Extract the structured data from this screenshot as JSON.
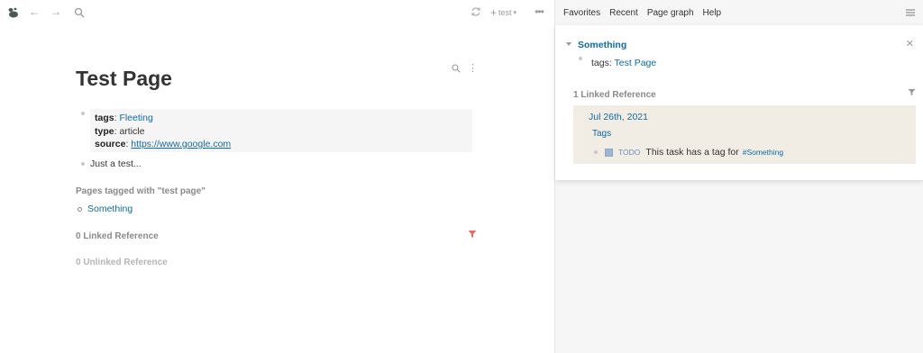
{
  "topbar": {
    "logo_icon": "logseq-logo-icon",
    "back_icon": "arrow-left-icon",
    "forward_icon": "arrow-right-icon",
    "search_icon": "search-icon",
    "sync_icon": "refresh-icon",
    "new_page_label": "test",
    "more_icon": "ellipsis-icon"
  },
  "page": {
    "title": "Test Page",
    "properties": {
      "tags_key": "tags",
      "tags_value": "Fleeting",
      "type_key": "type",
      "type_value": "article",
      "source_key": "source",
      "source_value": "https://www.google.com"
    },
    "block2": "Just a test...",
    "tagged_header": "Pages tagged with \"test page\"",
    "tagged_items": [
      "Something"
    ],
    "linked_ref": "0 Linked Reference",
    "unlinked_ref": "0 Unlinked Reference"
  },
  "sidebar": {
    "nav": [
      "Favorites",
      "Recent",
      "Page graph",
      "Help"
    ],
    "card": {
      "title": "Something",
      "tags_key": "tags",
      "tags_value": "Test Page",
      "linked_ref": "1 Linked Reference",
      "ref_date": "Jul 26th, 2021",
      "ref_tags": "Tags",
      "todo_label": "TODO",
      "task_text": "This task has a tag for",
      "hashtag": "#Something"
    }
  },
  "colors": {
    "link": "#106ba3",
    "ref_bg": "#f1ede4",
    "filter_active": "#e86b6b"
  }
}
